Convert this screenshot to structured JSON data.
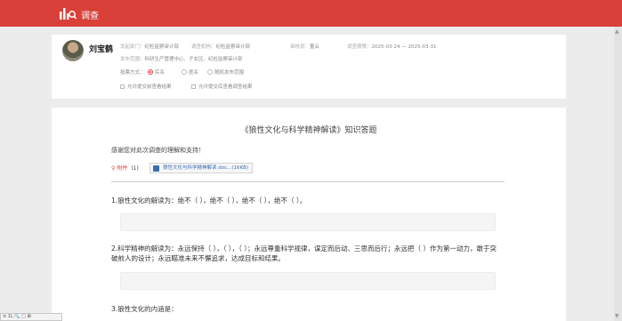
{
  "app": {
    "title": "调查"
  },
  "user": {
    "name": "刘宝鹤"
  },
  "meta": {
    "dept_label": "发起部门：",
    "dept_value": "纪检监察审计部",
    "org_label": "调查机构：",
    "org_value": "纪检监察审计部",
    "reviewer_label": "审核员：",
    "reviewer_value": "董云",
    "period_label": "调查期限：",
    "period_value": "2025-03-24 — 2025-03-31",
    "scope_label": "发布范围：",
    "scope_value": "科研生产管理中心、子女区、纪检监察审计部"
  },
  "vote": {
    "label": "投票方式：",
    "options": [
      "实名",
      "匿名",
      "随机发布范围"
    ],
    "selected": "实名"
  },
  "checks": [
    "允许提交前查看结果",
    "允许提交后查看调查结果"
  ],
  "doc": {
    "title": "《狼性文化与科学精神解读》知识答题",
    "thanks": "感谢您对此次调查的理解和支持！",
    "attach_label": "附件",
    "attach_count": "(1)",
    "file_name": "狼性文化与科学精神解读.doc...(16KB)"
  },
  "questions": [
    {
      "text": "1.狼性文化的解读为：绝不（ ），绝不（ ），绝不（ ），绝不（ ）。"
    },
    {
      "text": "2.科学精神的解读为：永远保持（ ），（ ），（ ）；永远尊重科学规律，谋定而后动、三思而后行；永远把（ ）作为第一动力，敢于突破前人的设计；永远瞄准未来不懈追求，达成目标和结果。"
    },
    {
      "text": "3.狼性文化的内涵是："
    }
  ],
  "mini_toolbar": {
    "text": "≡ 1L 🔍 □ ⊠"
  }
}
